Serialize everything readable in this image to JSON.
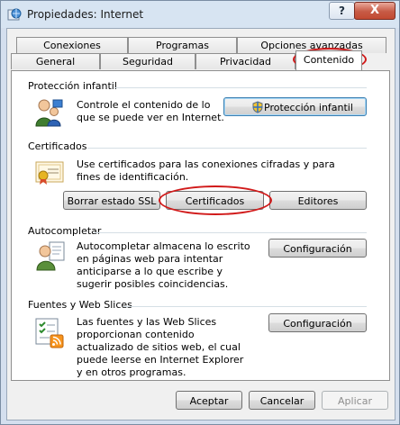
{
  "window": {
    "title": "Propiedades: Internet",
    "help_label": "?",
    "close_label": "X"
  },
  "tabs_row1": [
    "Conexiones",
    "Programas",
    "Opciones avanzadas"
  ],
  "tabs_row2": [
    "General",
    "Seguridad",
    "Privacidad",
    "Contenido"
  ],
  "parental": {
    "title": "Protección infantil",
    "description": "Controle el contenido de lo que se puede ver en Internet.",
    "button": "Protección infantil"
  },
  "certificates": {
    "title": "Certificados",
    "description": "Use certificados para las conexiones cifradas y para fines de identificación.",
    "buttons": [
      "Borrar estado SSL",
      "Certificados",
      "Editores"
    ]
  },
  "autocomplete": {
    "title": "Autocompletar",
    "description": "Autocompletar almacena lo escrito en páginas web para intentar anticiparse a lo que escribe y sugerir posibles coincidencias.",
    "button": "Configuración"
  },
  "feeds": {
    "title": "Fuentes y Web Slices",
    "description": "Las fuentes y las Web Slices proporcionan contenido actualizado de sitios web, el cual puede leerse en Internet Explorer y en otros programas.",
    "button": "Configuración"
  },
  "footer": {
    "ok": "Aceptar",
    "cancel": "Cancelar",
    "apply": "Aplicar"
  },
  "colors": {
    "highlight_oval": "#d11a1a"
  },
  "icons": [
    "internet-options-icon",
    "parental-control-icon",
    "certificate-icon",
    "autocomplete-icon",
    "feeds-icon",
    "shield-icon"
  ]
}
